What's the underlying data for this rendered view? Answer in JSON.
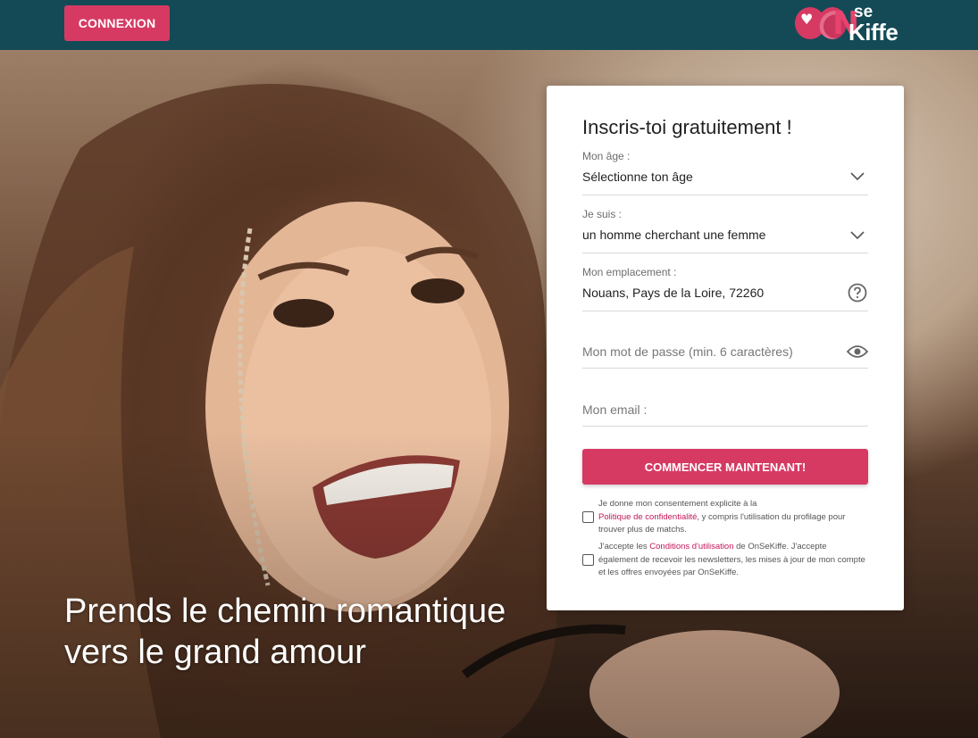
{
  "header": {
    "login_label": "CONNEXION",
    "logo": {
      "se": "se",
      "kiffe": "Kiffe",
      "n": "N"
    }
  },
  "hero": {
    "tagline_line1": "Prends le chemin romantique",
    "tagline_line2": "vers le grand amour"
  },
  "form": {
    "title": "Inscris-toi gratuitement !",
    "age": {
      "label": "Mon âge :",
      "value": "Sélectionne ton âge"
    },
    "gender": {
      "label": "Je suis :",
      "value": "un homme cherchant une femme"
    },
    "location": {
      "label": "Mon emplacement :",
      "value": "Nouans, Pays de la Loire, 72260"
    },
    "password": {
      "placeholder": "Mon mot de passe (min. 6 caractères)"
    },
    "email": {
      "placeholder": "Mon email :"
    },
    "submit_label": "COMMENCER MAINTENANT!",
    "consent1": {
      "pre": "Je donne mon consentement explicite à la",
      "link": "Politique de confidentialité",
      "post": ", y compris l'utilisation du profilage pour trouver plus de matchs."
    },
    "consent2": {
      "pre": "J'accepte les ",
      "link": "Conditions d'utilisation",
      "post": " de OnSeKiffe. J'accepte également de recevoir les newsletters, les mises à jour de mon compte et les offres envoyées par OnSeKiffe."
    }
  },
  "colors": {
    "header_bg": "#134a56",
    "accent": "#d63a63"
  }
}
